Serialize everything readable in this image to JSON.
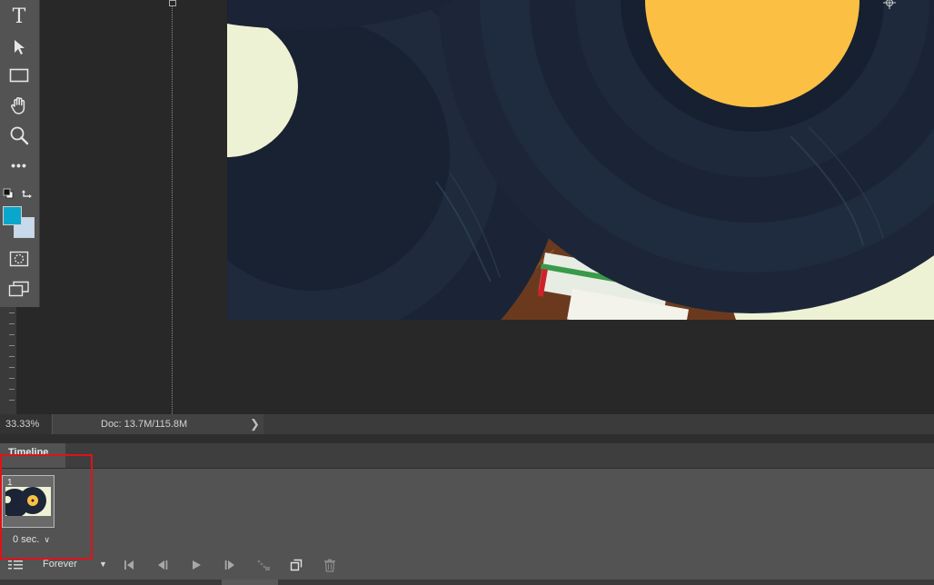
{
  "toolbar": {
    "tools": [
      {
        "name": "type-tool-icon",
        "glyph": "T"
      },
      {
        "name": "path-selection-tool-icon"
      },
      {
        "name": "rectangle-tool-icon"
      },
      {
        "name": "hand-tool-icon"
      },
      {
        "name": "zoom-tool-icon"
      },
      {
        "name": "edit-toolbar-icon",
        "glyph": "•••"
      },
      {
        "name": "default-colors-icon"
      },
      {
        "name": "swap-colors-icon"
      },
      {
        "name": "quick-mask-icon"
      },
      {
        "name": "screen-mode-icon"
      }
    ],
    "foreground_color": "#0aa6cc",
    "background_color": "#c9d9ec"
  },
  "status": {
    "zoom": "33.33%",
    "doc": "Doc: 13.7M/115.8M",
    "arrow": "❯"
  },
  "timeline": {
    "tab_label": "Timeline",
    "frames": [
      {
        "number": "1",
        "delay": "0 sec."
      }
    ],
    "loop": "Forever",
    "colors": {
      "highlight": "#e0111b"
    }
  }
}
